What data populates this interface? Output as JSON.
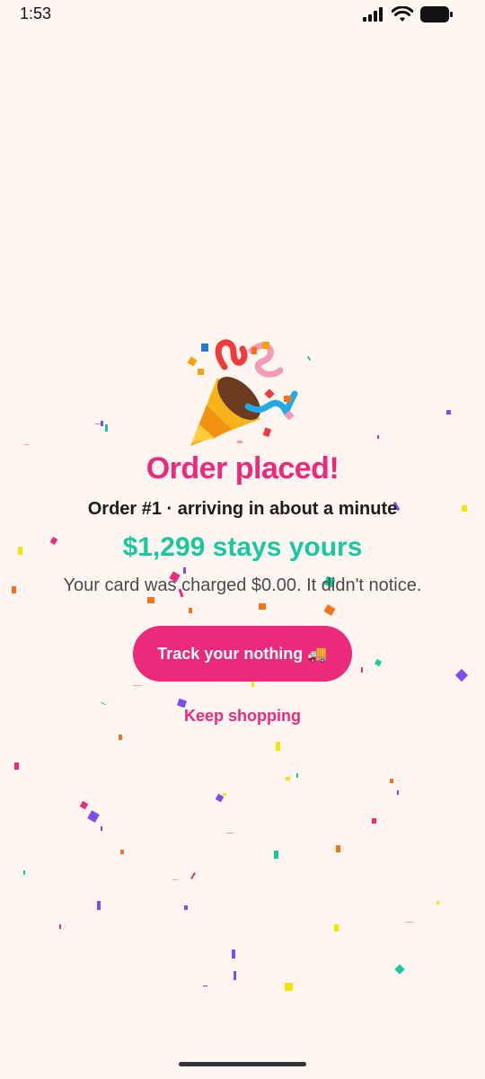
{
  "status_bar": {
    "time": "1:53",
    "icons": [
      "signal-icon",
      "wifi-icon",
      "battery-icon"
    ]
  },
  "celebration": {
    "emoji": "party-popper-icon",
    "title": "Order placed!",
    "order_line": "Order #1 · arriving in about a minute",
    "savings": "$1,299 stays yours",
    "charged_note": "Your card was charged $0.00. It didn't notice."
  },
  "actions": {
    "track_label": "Track your nothing 🚚",
    "keep_shopping_label": "Keep shopping"
  },
  "colors": {
    "background": "#fff6f2",
    "accent": "#ec2a7b",
    "savings": "#18c9a0"
  }
}
